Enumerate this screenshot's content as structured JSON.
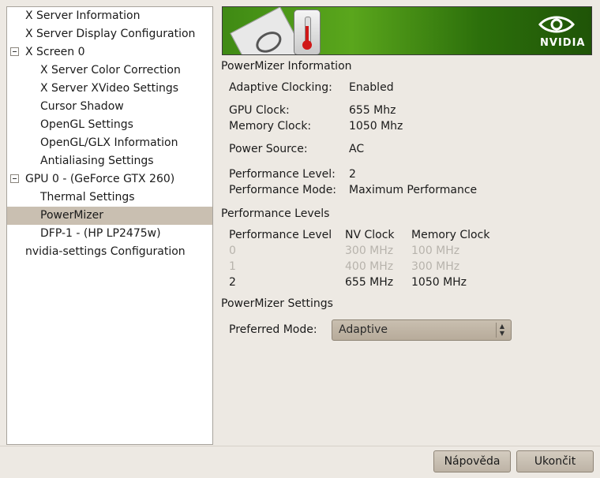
{
  "tree": {
    "items": [
      {
        "label": "X Server Information",
        "expander": false,
        "selected": false
      },
      {
        "label": "X Server Display Configuration",
        "expander": false,
        "selected": false
      },
      {
        "label": "X Screen 0",
        "expander": true,
        "selected": false
      },
      {
        "label": "X Server Color Correction",
        "expander": false,
        "selected": false
      },
      {
        "label": "X Server XVideo Settings",
        "expander": false,
        "selected": false
      },
      {
        "label": "Cursor Shadow",
        "expander": false,
        "selected": false
      },
      {
        "label": "OpenGL Settings",
        "expander": false,
        "selected": false
      },
      {
        "label": "OpenGL/GLX Information",
        "expander": false,
        "selected": false
      },
      {
        "label": "Antialiasing Settings",
        "expander": false,
        "selected": false
      },
      {
        "label": "GPU 0 - (GeForce GTX 260)",
        "expander": true,
        "selected": false
      },
      {
        "label": "Thermal Settings",
        "expander": false,
        "selected": false
      },
      {
        "label": "PowerMizer",
        "expander": false,
        "selected": true
      },
      {
        "label": "DFP-1 - (HP LP2475w)",
        "expander": false,
        "selected": false
      },
      {
        "label": "nvidia-settings Configuration",
        "expander": false,
        "selected": false
      }
    ]
  },
  "banner": {
    "brand": "NVIDIA",
    "icon": "thermometer-icon"
  },
  "info": {
    "title": "PowerMizer Information",
    "adaptive_label": "Adaptive Clocking:",
    "adaptive_value": "Enabled",
    "gpu_clock_label": "GPU Clock:",
    "gpu_clock_value": "655 Mhz",
    "mem_clock_label": "Memory Clock:",
    "mem_clock_value": "1050 Mhz",
    "power_source_label": "Power Source:",
    "power_source_value": "AC",
    "perf_level_label": "Performance Level:",
    "perf_level_value": "2",
    "perf_mode_label": "Performance Mode:",
    "perf_mode_value": "Maximum Performance"
  },
  "levels": {
    "title": "Performance Levels",
    "headers": {
      "level": "Performance Level",
      "nv": "NV Clock",
      "mem": "Memory Clock"
    },
    "rows": [
      {
        "level": "0",
        "nv": "300 MHz",
        "mem": "100 MHz",
        "active": false
      },
      {
        "level": "1",
        "nv": "400 MHz",
        "mem": "300 MHz",
        "active": false
      },
      {
        "level": "2",
        "nv": "655 MHz",
        "mem": "1050 MHz",
        "active": true
      }
    ]
  },
  "settings": {
    "title": "PowerMizer Settings",
    "preferred_label": "Preferred Mode:",
    "preferred_value": "Adaptive"
  },
  "buttons": {
    "help": "Nápověda",
    "quit": "Ukončit"
  }
}
